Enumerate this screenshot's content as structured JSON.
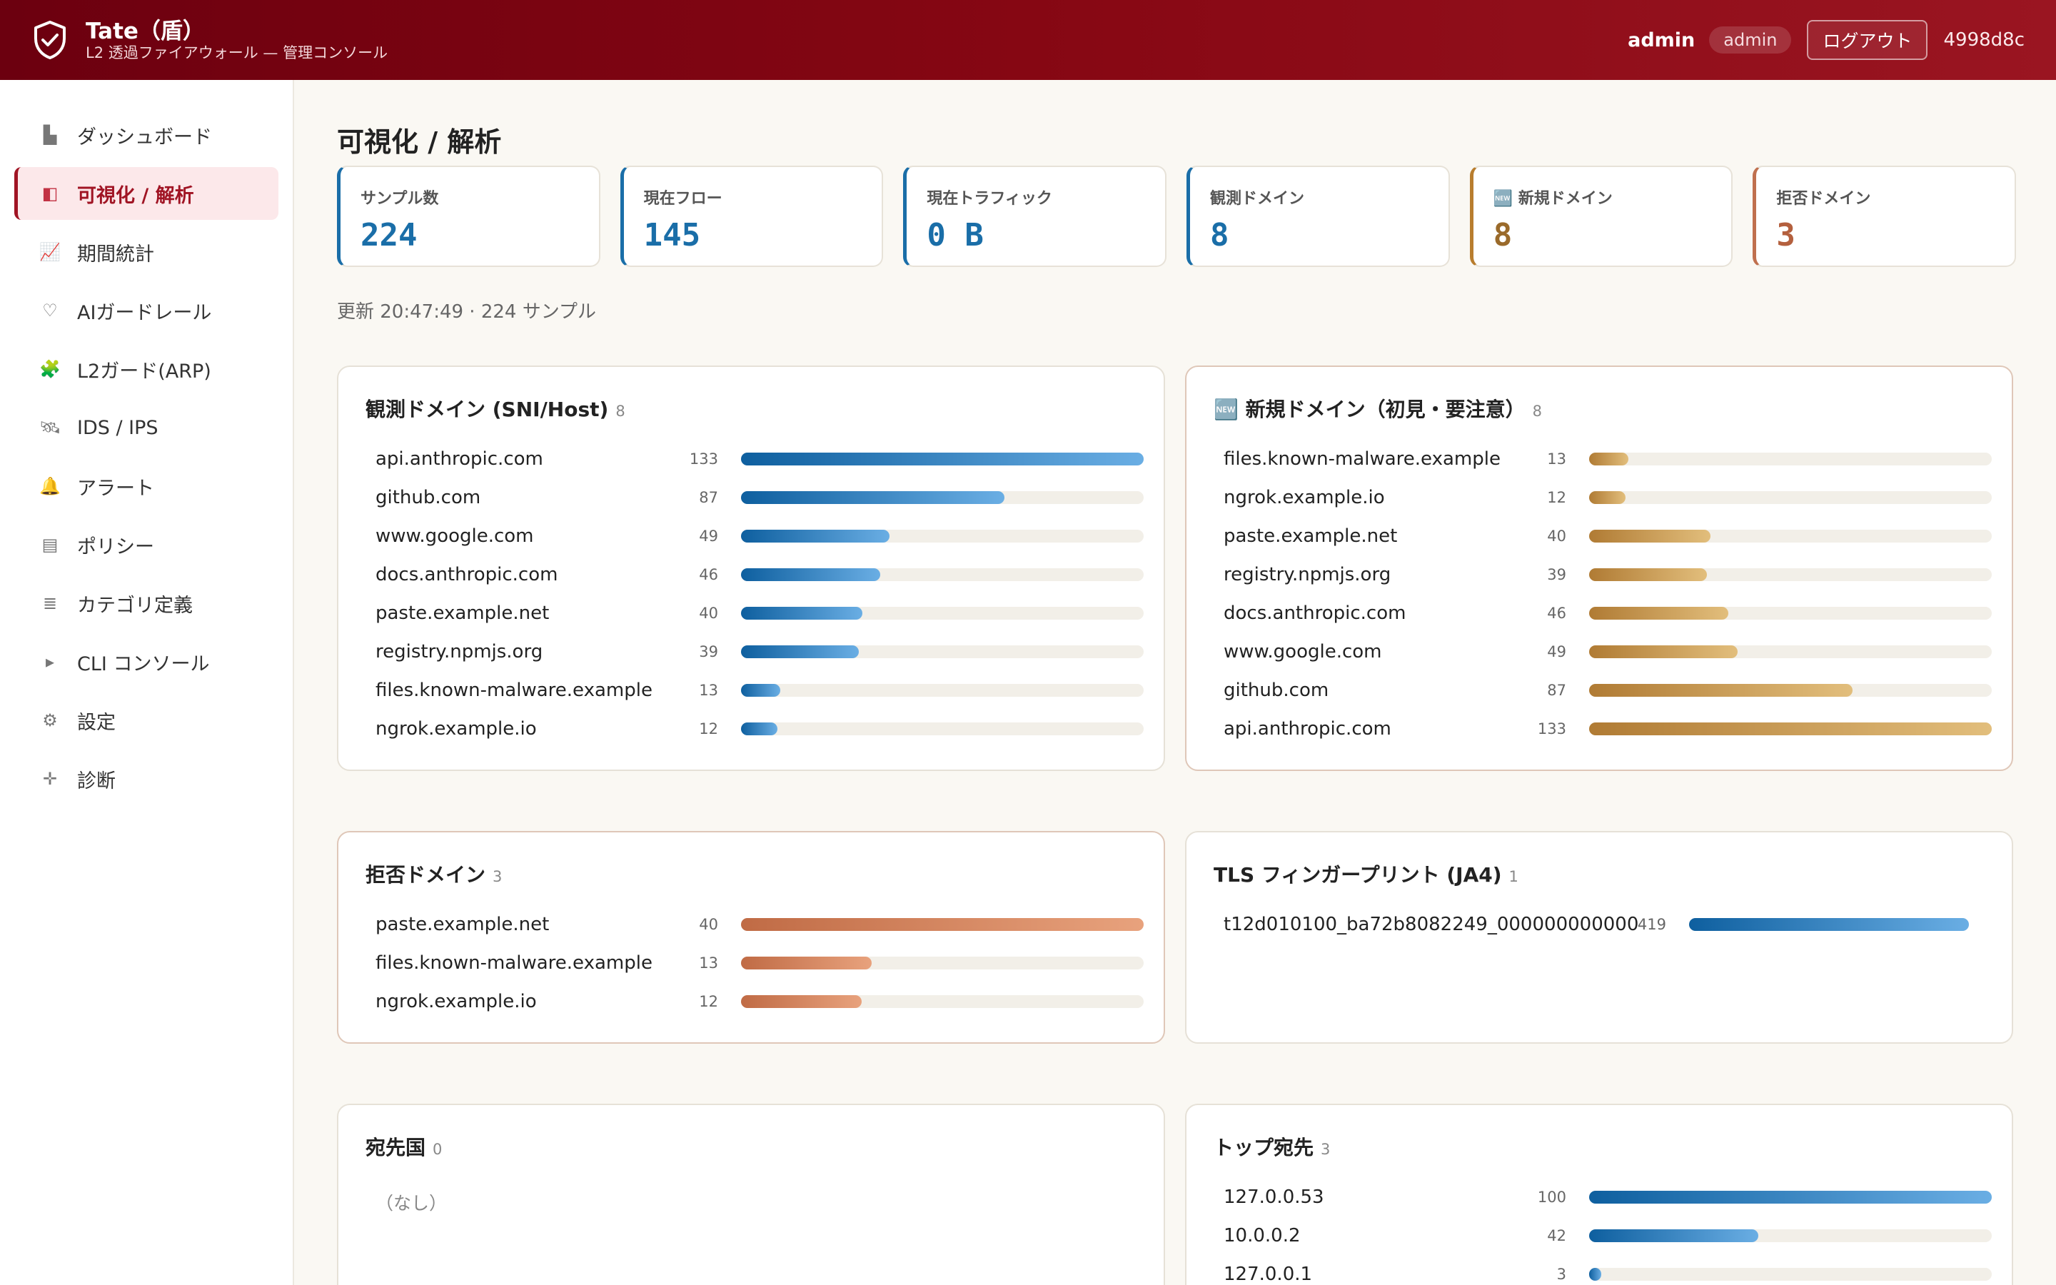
{
  "header": {
    "title": "Tate（盾）",
    "subtitle": "L2 透過ファイアウォール — 管理コンソール",
    "user": "admin",
    "role": "admin",
    "logout_label": "ログアウト",
    "version": "4998d8c",
    "accent": "#860713"
  },
  "sidebar": {
    "items": [
      {
        "icon": "bar-chart-icon",
        "glyph": "▙",
        "label": "ダッシュボード"
      },
      {
        "icon": "visualize-icon",
        "glyph": "◧",
        "label": "可視化 / 解析",
        "active": true
      },
      {
        "icon": "trend-icon",
        "glyph": "📈",
        "label": "期間統計"
      },
      {
        "icon": "shield-icon",
        "glyph": "♡",
        "label": "AIガードレール"
      },
      {
        "icon": "puzzle-icon",
        "glyph": "🧩",
        "label": "L2ガード(ARP)"
      },
      {
        "icon": "satellite-icon",
        "glyph": "🛰",
        "label": "IDS / IPS"
      },
      {
        "icon": "bell-icon",
        "glyph": "🔔",
        "label": "アラート"
      },
      {
        "icon": "policy-icon",
        "glyph": "▤",
        "label": "ポリシー"
      },
      {
        "icon": "list-icon",
        "glyph": "≣",
        "label": "カテゴリ定義"
      },
      {
        "icon": "terminal-icon",
        "glyph": "▸",
        "label": "CLI コンソール"
      },
      {
        "icon": "gear-icon",
        "glyph": "⚙",
        "label": "設定"
      },
      {
        "icon": "diagnostic-icon",
        "glyph": "✛",
        "label": "診断"
      }
    ]
  },
  "main": {
    "title": "可視化 / 解析",
    "stats": [
      {
        "label": "サンプル数",
        "value": "224",
        "kind": "normal"
      },
      {
        "label": "現在フロー",
        "value": "145",
        "kind": "normal"
      },
      {
        "label": "現在トラフィック",
        "value": "0 B",
        "kind": "normal"
      },
      {
        "label": "観測ドメイン",
        "value": "8",
        "kind": "normal"
      },
      {
        "label": "🆕 新規ドメイン",
        "value": "8",
        "kind": "warn"
      },
      {
        "label": "拒否ドメイン",
        "value": "3",
        "kind": "deny"
      }
    ],
    "updated": "更新 20:47:49 · 224 サンプル"
  },
  "panels": {
    "observed": {
      "title": "観測ドメイン (SNI/Host)",
      "count": "8",
      "rows": [
        {
          "label": "api.anthropic.com",
          "value": 133
        },
        {
          "label": "github.com",
          "value": 87
        },
        {
          "label": "www.google.com",
          "value": 49
        },
        {
          "label": "docs.anthropic.com",
          "value": 46
        },
        {
          "label": "paste.example.net",
          "value": 40
        },
        {
          "label": "registry.npmjs.org",
          "value": 39
        },
        {
          "label": "files.known-malware.example",
          "value": 13
        },
        {
          "label": "ngrok.example.io",
          "value": 12
        }
      ]
    },
    "new": {
      "title": "🆕 新規ドメイン（初見・要注意）",
      "count": "8",
      "rows": [
        {
          "label": "files.known-malware.example",
          "value": 13
        },
        {
          "label": "ngrok.example.io",
          "value": 12
        },
        {
          "label": "paste.example.net",
          "value": 40
        },
        {
          "label": "registry.npmjs.org",
          "value": 39
        },
        {
          "label": "docs.anthropic.com",
          "value": 46
        },
        {
          "label": "www.google.com",
          "value": 49
        },
        {
          "label": "github.com",
          "value": 87
        },
        {
          "label": "api.anthropic.com",
          "value": 133
        }
      ]
    },
    "denied": {
      "title": "拒否ドメイン",
      "count": "3",
      "rows": [
        {
          "label": "paste.example.net",
          "value": 40
        },
        {
          "label": "files.known-malware.example",
          "value": 13
        },
        {
          "label": "ngrok.example.io",
          "value": 12
        }
      ]
    },
    "tls": {
      "title": "TLS フィンガープリント (JA4)",
      "count": "1",
      "rows": [
        {
          "label": "t12d010100_ba72b8082249_000000000000",
          "value": 419
        }
      ]
    },
    "country": {
      "title": "宛先国",
      "count": "0",
      "empty": "（なし）"
    },
    "dest": {
      "title": "トップ宛先",
      "count": "3",
      "rows": [
        {
          "label": "127.0.0.53",
          "value": 100
        },
        {
          "label": "10.0.0.2",
          "value": 42
        },
        {
          "label": "127.0.0.1",
          "value": 3
        }
      ]
    }
  }
}
